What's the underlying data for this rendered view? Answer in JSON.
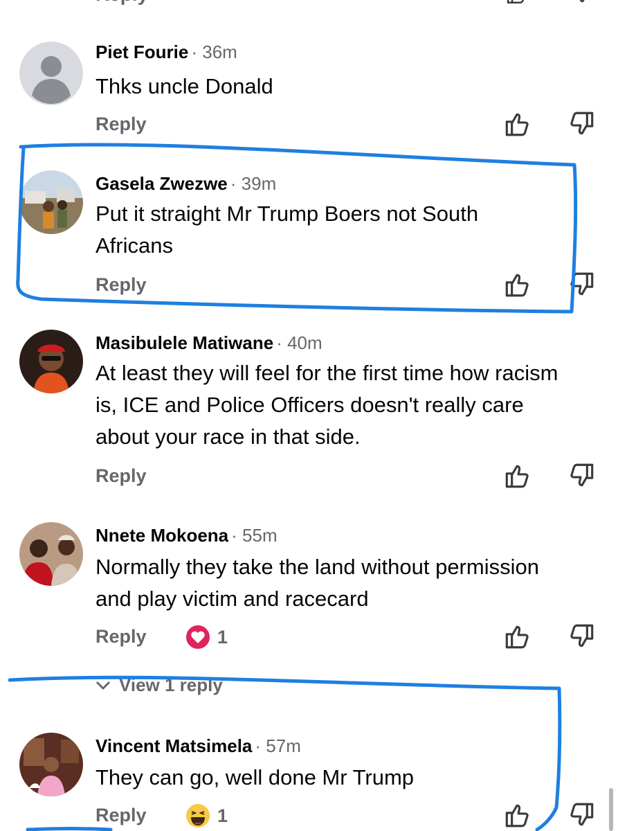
{
  "top_partial": {
    "reply_label": "Reply"
  },
  "comments": [
    {
      "author": "Piet Fourie",
      "time": "· 36m",
      "text": "Thks uncle Donald",
      "reply_label": "Reply",
      "avatar": "default-profile-silhouette"
    },
    {
      "author": "Gasela Zwezwe",
      "time": "· 39m",
      "text": "Put it straight Mr Trump Boers not South Africans",
      "reply_label": "Reply",
      "avatar": "profile-photo"
    },
    {
      "author": "Masibulele Matiwane",
      "time": "· 40m",
      "text": "At least they will feel for the first time how racism is, ICE and Police Officers doesn't really care about your race in that side.",
      "reply_label": "Reply",
      "avatar": "profile-photo"
    },
    {
      "author": "Nnete Mokoena",
      "time": "· 55m",
      "text": "Normally they take the land without permission and play victim and racecard",
      "reply_label": "Reply",
      "avatar": "profile-photo",
      "reaction": {
        "icon": "love-reaction-icon",
        "count": "1"
      }
    },
    {
      "author": "Vincent Matsimela",
      "time": "· 57m",
      "text": "They can go, well done Mr Trump",
      "reply_label": "Reply",
      "avatar": "profile-photo",
      "reaction": {
        "icon": "haha-reaction-icon",
        "count": "1"
      }
    }
  ],
  "view_replies": {
    "label": "View 1 reply"
  },
  "colors": {
    "text": "#050505",
    "secondary_text": "#65676b",
    "love_reaction": "#e0245e",
    "haha_reaction": "#f7c948",
    "annotation_ink": "#1f7fe0",
    "default_avatar_bg": "#d8dadf",
    "default_avatar_fg": "#8a8d91"
  }
}
